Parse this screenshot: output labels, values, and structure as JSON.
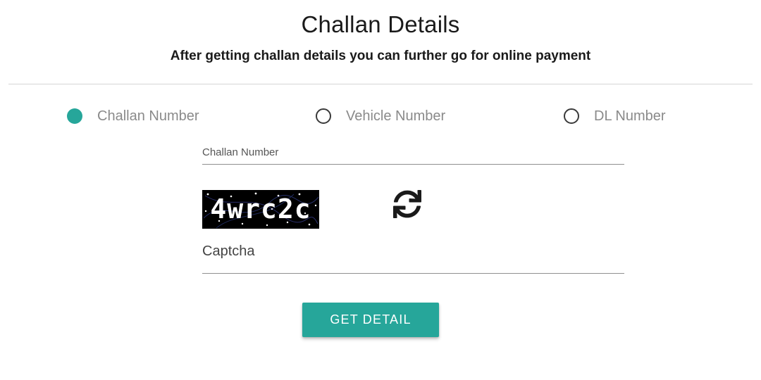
{
  "header": {
    "title": "Challan Details",
    "subtitle": "After getting challan details you can further go for online payment"
  },
  "search_type": {
    "selected": "Challan Number",
    "options": [
      {
        "label": "Challan Number",
        "checked": true
      },
      {
        "label": "Vehicle Number",
        "checked": false
      },
      {
        "label": "DL Number",
        "checked": false
      }
    ]
  },
  "form": {
    "challan_field_label": "Challan Number",
    "challan_value": "",
    "captcha_image_text": "4wrc2c",
    "refresh_icon": "refresh-icon",
    "captcha_field_label": "Captcha",
    "captcha_value": "",
    "submit_label": "GET DETAIL"
  },
  "colors": {
    "accent": "#26a69a",
    "text_muted": "#8a8a8a",
    "divider": "#d6d6d6"
  }
}
